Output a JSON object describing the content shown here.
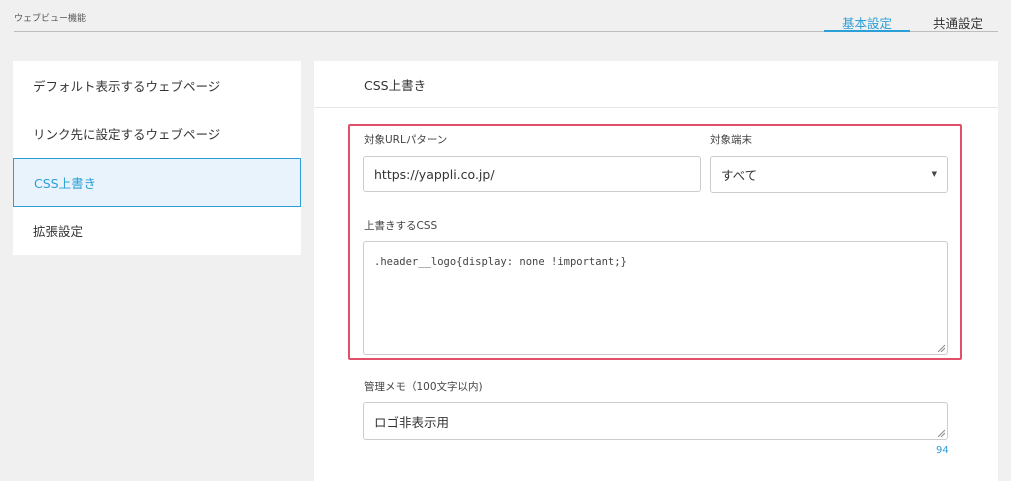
{
  "header": {
    "page_title": "ウェブビュー機能",
    "tabs": [
      {
        "label": "基本設定",
        "active": true
      },
      {
        "label": "共通設定",
        "active": false
      }
    ]
  },
  "sidebar": {
    "items": [
      {
        "label": "デフォルト表示するウェブページ",
        "active": false
      },
      {
        "label": "リンク先に設定するウェブページ",
        "active": false
      },
      {
        "label": "CSS上書き",
        "active": true
      },
      {
        "label": "拡張設定",
        "active": false
      }
    ]
  },
  "main": {
    "title": "CSS上書き",
    "url_pattern": {
      "label": "対象URLパターン",
      "value": "https://yappli.co.jp/"
    },
    "device": {
      "label": "対象端末",
      "value": "すべて"
    },
    "css": {
      "label": "上書きするCSS",
      "value": ".header__logo{display: none !important;}"
    },
    "memo": {
      "label": "管理メモ（100文字以内)",
      "value": "ロゴ非表示用",
      "remaining": "94"
    }
  },
  "colors": {
    "accent": "#2b9fd7",
    "highlight": "#e0506a"
  }
}
